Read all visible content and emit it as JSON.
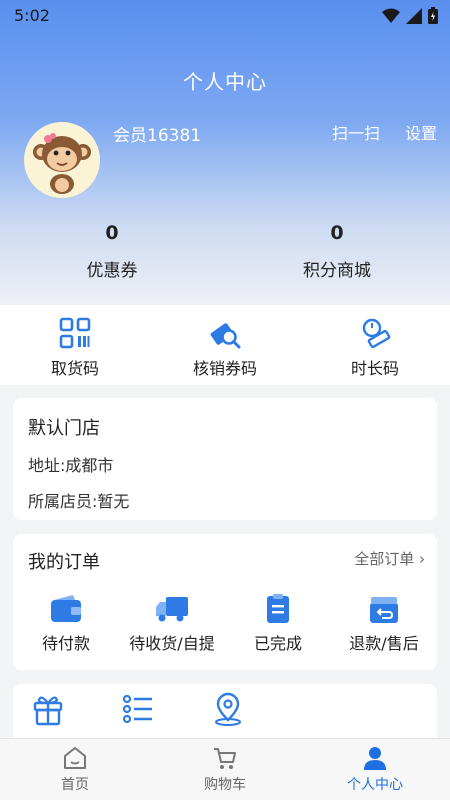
{
  "status": {
    "time": "5:02"
  },
  "header": {
    "title": "个人中心",
    "member": "会员16381",
    "scan": "扫一扫",
    "settings": "设置"
  },
  "stats": [
    {
      "value": "0",
      "label": "优惠券"
    },
    {
      "value": "0",
      "label": "积分商城"
    }
  ],
  "quick": [
    {
      "label": "取货码",
      "icon": "qr-code-icon"
    },
    {
      "label": "核销券码",
      "icon": "coupon-scan-icon"
    },
    {
      "label": "时长码",
      "icon": "duration-ruler-icon"
    }
  ],
  "store": {
    "title": "默认门店",
    "address": "地址:成都市",
    "clerk": "所属店员:暂无"
  },
  "orders": {
    "title": "我的订单",
    "all": "全部订单",
    "items": [
      {
        "label": "待付款",
        "icon": "wallet-icon"
      },
      {
        "label": "待收货/自提",
        "icon": "truck-icon"
      },
      {
        "label": "已完成",
        "icon": "clipboard-icon"
      },
      {
        "label": "退款/售后",
        "icon": "refund-box-icon"
      }
    ]
  },
  "more": {
    "items": [
      {
        "icon": "gift-icon"
      },
      {
        "icon": "list-icon"
      },
      {
        "icon": "location-icon"
      }
    ]
  },
  "tabs": [
    {
      "label": "首页",
      "icon": "home-icon",
      "active": false
    },
    {
      "label": "购物车",
      "icon": "cart-icon",
      "active": false
    },
    {
      "label": "个人中心",
      "icon": "user-icon",
      "active": true
    }
  ],
  "colors": {
    "accent": "#1f6fe0",
    "hero_top": "#5a8ff0",
    "icon_blue": "#2f7be6"
  }
}
